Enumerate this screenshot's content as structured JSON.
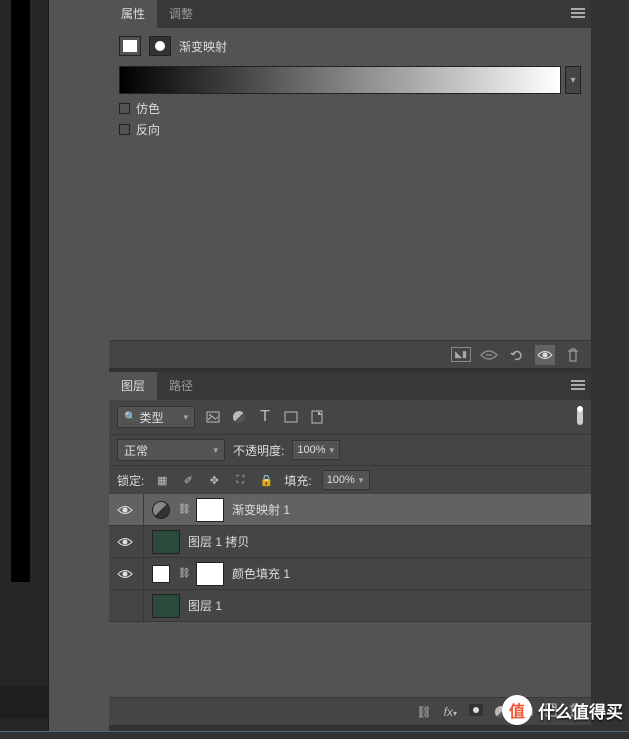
{
  "properties_panel": {
    "tabs": {
      "properties": "属性",
      "adjustments": "调整"
    },
    "adjustment_type": "渐变映射",
    "checkboxes": {
      "dither": "仿色",
      "reverse": "反向"
    }
  },
  "layers_panel": {
    "tabs": {
      "layers": "图层",
      "paths": "路径"
    },
    "filter": {
      "label": "类型"
    },
    "blend_mode": "正常",
    "opacity": {
      "label": "不透明度:",
      "value": "100%"
    },
    "lock": {
      "label": "锁定:"
    },
    "fill": {
      "label": "填充:",
      "value": "100%"
    },
    "layers": [
      {
        "name": "渐变映射 1"
      },
      {
        "name": "图层 1 拷贝"
      },
      {
        "name": "颜色填充 1"
      },
      {
        "name": "图层 1"
      }
    ]
  },
  "watermark": {
    "badge": "值",
    "text": "什么值得买"
  }
}
